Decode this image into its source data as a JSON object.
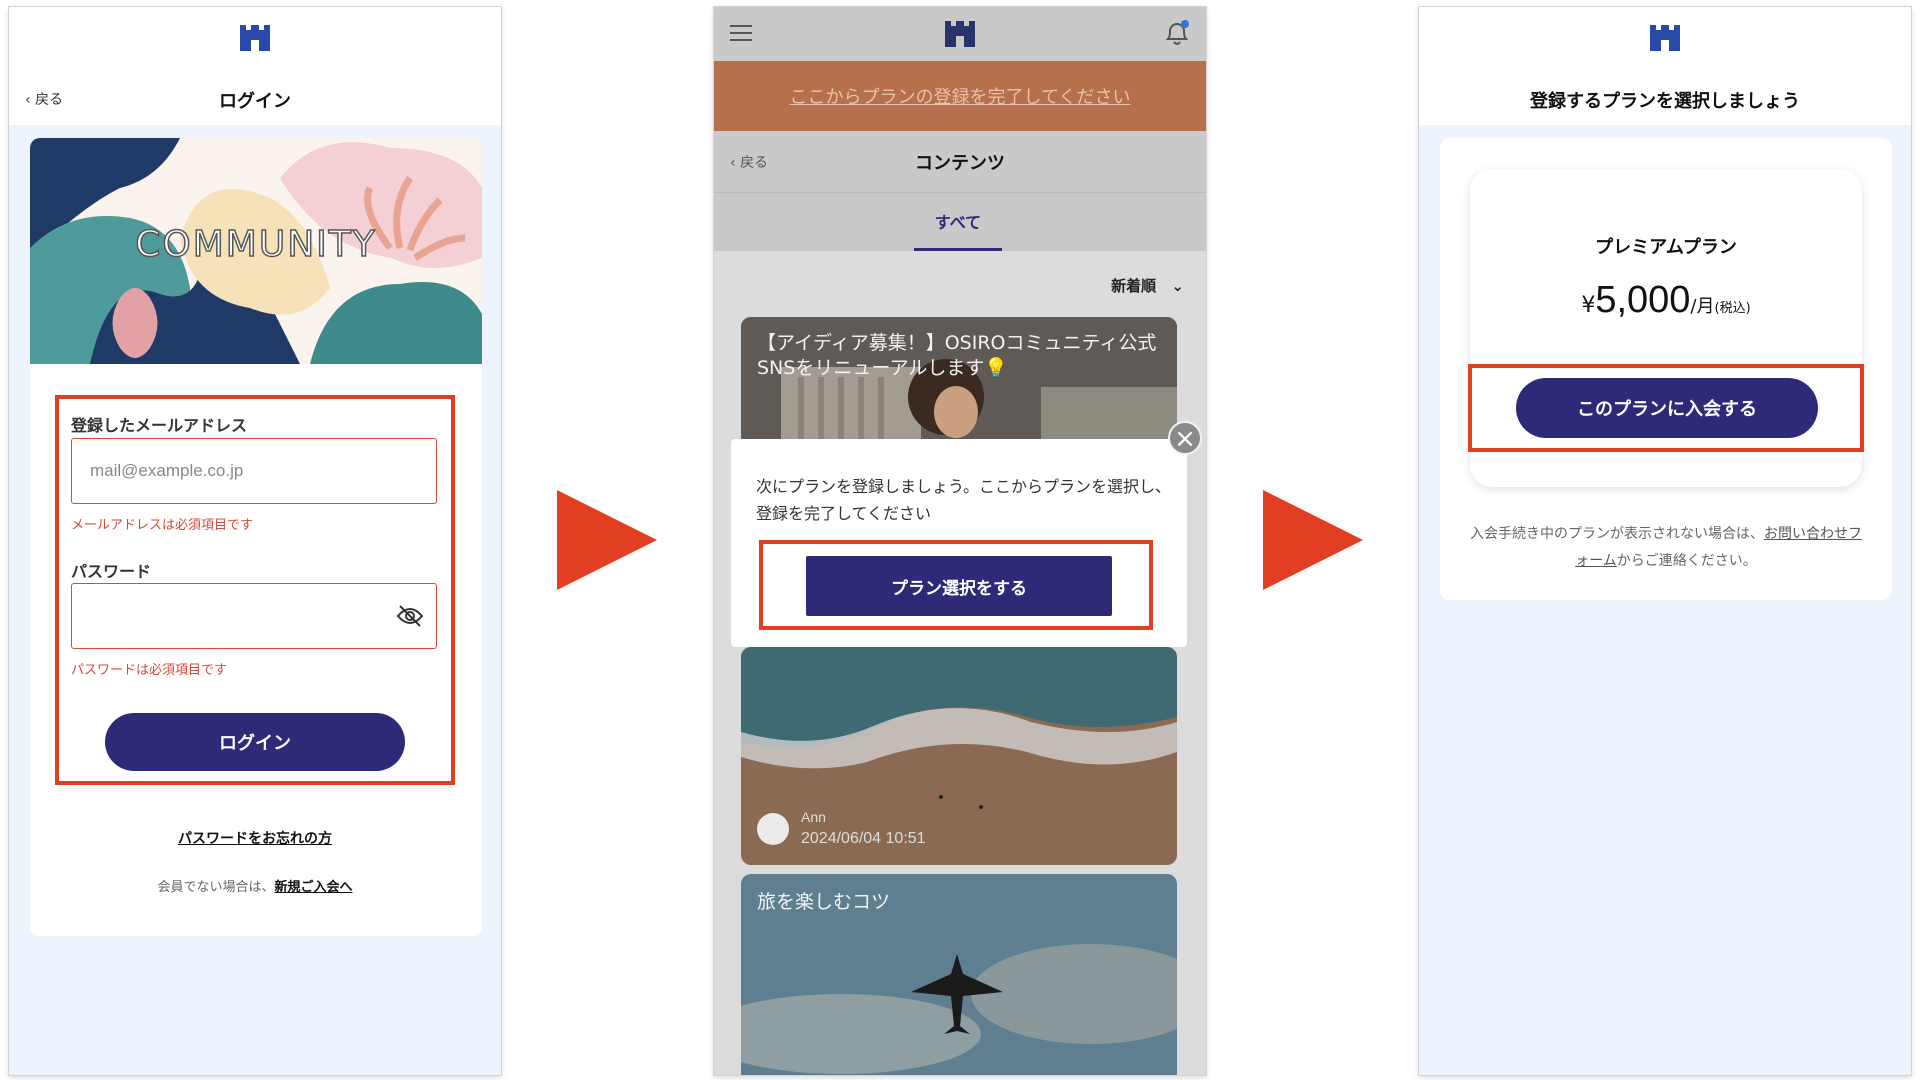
{
  "brand": {
    "primary": "#2e2a78",
    "highlight": "#e23e22",
    "error": "#d8483a",
    "icon": "castle-logo"
  },
  "screen1": {
    "back": "戻る",
    "title": "ログイン",
    "banner_text": "COMMUNITY",
    "email_label": "登録したメールアドレス",
    "email_placeholder": "mail@example.co.jp",
    "email_error": "メールアドレスは必須項目です",
    "password_label": "パスワード",
    "password_error": "パスワードは必須項目です",
    "login_button": "ログイン",
    "forgot_link": "パスワードをお忘れの方",
    "join_text": "会員でない場合は、",
    "join_link": "新規ご入会へ"
  },
  "screen2": {
    "banner_link": "ここからプランの登録を完了してください",
    "back": "戻る",
    "title": "コンテンツ",
    "tab_all": "すべて",
    "sort": "新着順",
    "post1_title": "【アイディア募集！】OSIROコミュニティ公式SNSをリニューアルします💡",
    "post2_author": "Ann",
    "post2_date": "2024/06/04 10:51",
    "post3_title": "旅を楽しむコツ",
    "modal_text": "次にプランを登録しましょう。ここからプランを選択し、登録を完了してください",
    "modal_button": "プラン選択をする",
    "close_glyph": "×"
  },
  "screen3": {
    "title": "登録するプランを選択しましょう",
    "plan_name": "プレミアムプラン",
    "currency": "¥",
    "price": "5,000",
    "per": "/月",
    "tax": "(税込)",
    "join_button": "このプランに入会する",
    "note_text": "入会手続き中のプランが表示されない場合は、",
    "note_link": "お問い合わせフォーム",
    "note_suffix": "からご連絡ください。"
  }
}
